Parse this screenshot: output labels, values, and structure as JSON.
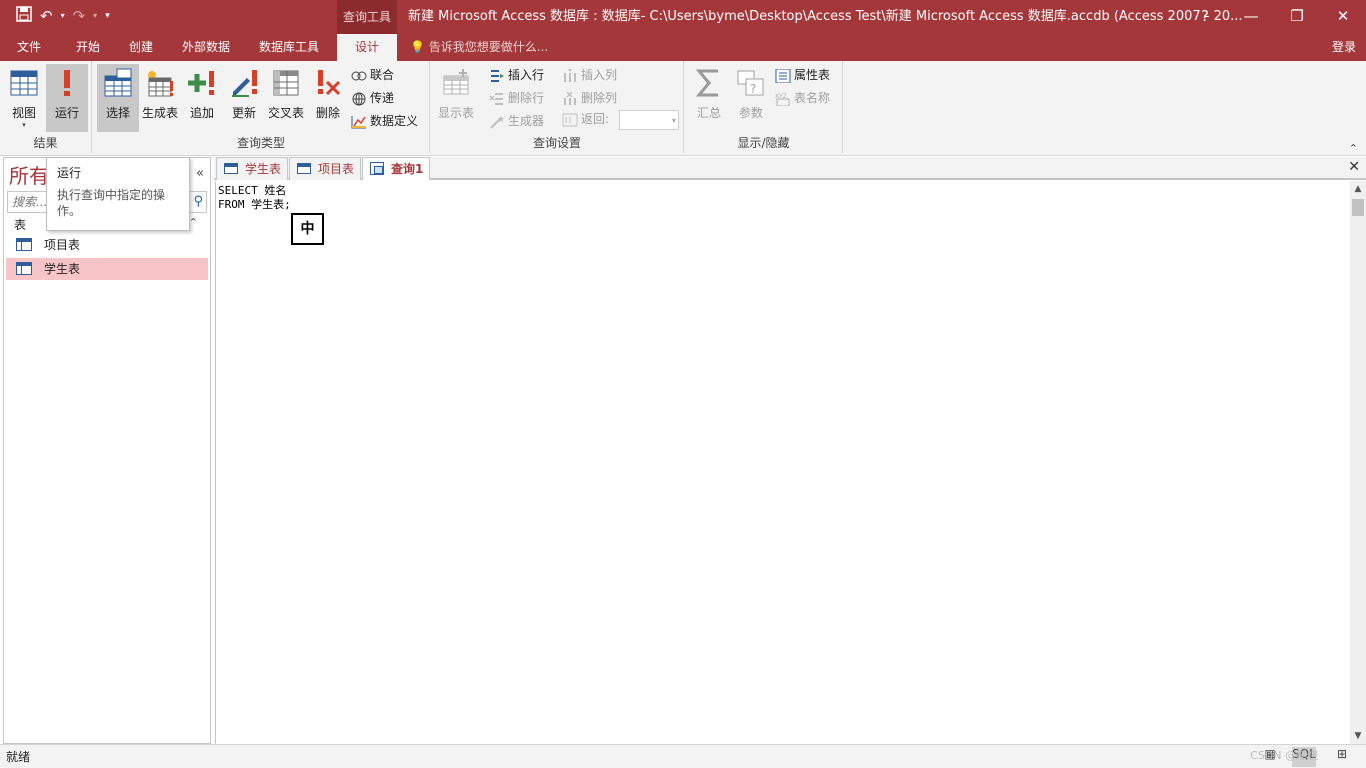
{
  "titlebar": {
    "context_tab": "查询工具",
    "window_title": "新建 Microsoft Access 数据库 : 数据库- C:\\Users\\byme\\Desktop\\Access Test\\新建 Microsoft Access 数据库.accdb (Access 2007 - 20...",
    "help": "?",
    "minimize": "—",
    "restore": "❐",
    "close": "✕"
  },
  "tabs": {
    "file": "文件",
    "home": "开始",
    "create": "创建",
    "external": "外部数据",
    "dbtools": "数据库工具",
    "design": "设计",
    "tell_me": "告诉我您想要做什么...",
    "login": "登录"
  },
  "ribbon": {
    "results": {
      "label": "结果",
      "view": "视图",
      "run": "运行"
    },
    "query_type": {
      "label": "查询类型",
      "select": "选择",
      "make_table": "生成表",
      "append": "追加",
      "update": "更新",
      "crosstab": "交叉表",
      "delete": "删除",
      "union": "联合",
      "pass_through": "传递",
      "data_definition": "数据定义"
    },
    "query_setup": {
      "label": "查询设置",
      "show_table": "显示表",
      "insert_rows": "插入行",
      "delete_rows": "删除行",
      "builder": "生成器",
      "insert_columns": "插入列",
      "delete_columns": "删除列",
      "return": "返回:"
    },
    "show_hide": {
      "label": "显示/隐藏",
      "totals": "汇总",
      "parameters": "参数",
      "property_sheet": "属性表",
      "table_names": "表名称"
    }
  },
  "nav": {
    "title": "所有",
    "search_placeholder": "搜索...",
    "section": "表",
    "items": [
      "项目表",
      "学生表"
    ]
  },
  "tooltip": {
    "title": "运行",
    "desc": "执行查询中指定的操作。"
  },
  "doctabs": [
    "学生表",
    "项目表",
    "查询1"
  ],
  "editor": {
    "sql": "SELECT 姓名\nFROM 学生表;",
    "ime": "中"
  },
  "status": {
    "text": "就绪",
    "watermark": "CSDN @燃烧"
  },
  "colors": {
    "accent": "#a4373a",
    "selected_nav": "#f7c5c8"
  }
}
